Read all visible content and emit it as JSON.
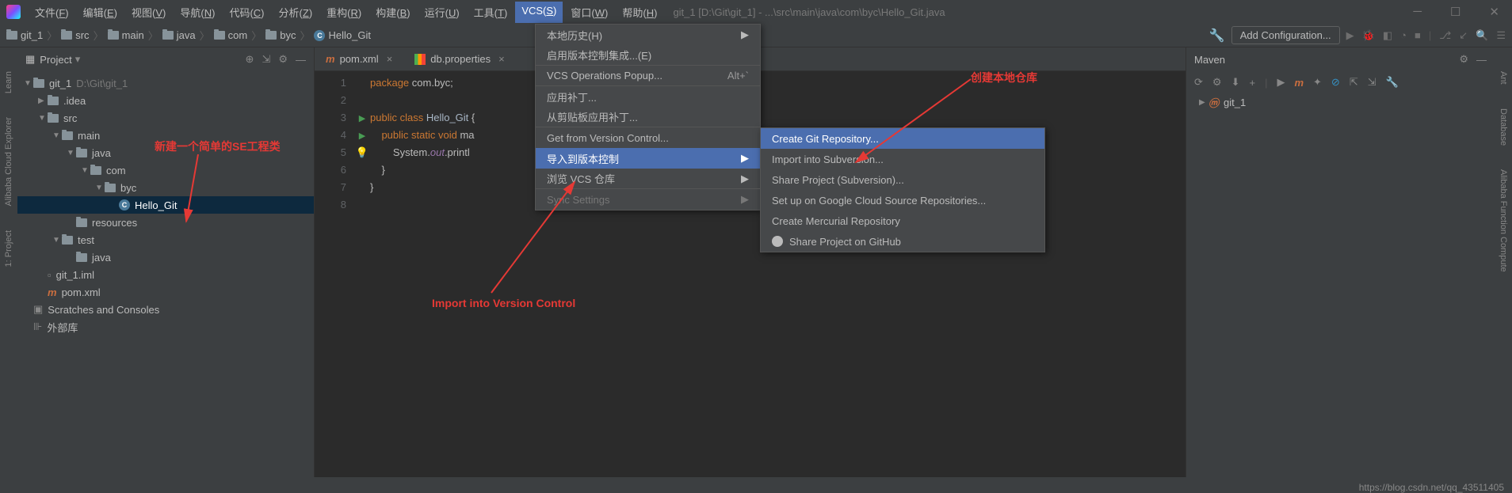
{
  "menubar": [
    "文件(F)",
    "编辑(E)",
    "视图(V)",
    "导航(N)",
    "代码(C)",
    "分析(Z)",
    "重构(R)",
    "构建(B)",
    "运行(U)",
    "工具(T)",
    "VCS(S)",
    "窗口(W)",
    "帮助(H)"
  ],
  "menubar_active_index": 10,
  "title_path": "git_1 [D:\\Git\\git_1] - ...\\src\\main\\java\\com\\byc\\Hello_Git.java",
  "breadcrumbs": [
    "git_1",
    "src",
    "main",
    "java",
    "com",
    "byc",
    "Hello_Git"
  ],
  "add_config": "Add Configuration...",
  "project_panel": {
    "title": "Project",
    "tree": [
      {
        "depth": 0,
        "arrow": "▼",
        "icon": "folder-root",
        "label": "git_1",
        "suffix": "D:\\Git\\git_1"
      },
      {
        "depth": 1,
        "arrow": "▶",
        "icon": "folder",
        "label": ".idea"
      },
      {
        "depth": 1,
        "arrow": "▼",
        "icon": "folder",
        "label": "src"
      },
      {
        "depth": 2,
        "arrow": "▼",
        "icon": "folder",
        "label": "main"
      },
      {
        "depth": 3,
        "arrow": "▼",
        "icon": "folder",
        "label": "java"
      },
      {
        "depth": 4,
        "arrow": "▼",
        "icon": "folder",
        "label": "com"
      },
      {
        "depth": 5,
        "arrow": "▼",
        "icon": "folder",
        "label": "byc"
      },
      {
        "depth": 6,
        "arrow": "",
        "icon": "class",
        "label": "Hello_Git",
        "selected": true
      },
      {
        "depth": 3,
        "arrow": "",
        "icon": "folder",
        "label": "resources"
      },
      {
        "depth": 2,
        "arrow": "▼",
        "icon": "folder",
        "label": "test"
      },
      {
        "depth": 3,
        "arrow": "",
        "icon": "folder",
        "label": "java"
      },
      {
        "depth": 1,
        "arrow": "",
        "icon": "file",
        "label": "git_1.iml"
      },
      {
        "depth": 1,
        "arrow": "",
        "icon": "m",
        "label": "pom.xml"
      },
      {
        "depth": 0,
        "arrow": "",
        "icon": "scratch",
        "label": "Scratches and Consoles"
      },
      {
        "depth": 0,
        "arrow": "",
        "icon": "lib",
        "label": "外部库"
      }
    ]
  },
  "tabs": [
    {
      "icon": "m",
      "label": "pom.xml"
    },
    {
      "icon": "prop",
      "label": "db.properties"
    }
  ],
  "code": {
    "lines": [
      {
        "n": 1,
        "html": "<span class='kw'>package</span> com.byc;"
      },
      {
        "n": 2,
        "html": ""
      },
      {
        "n": 3,
        "html": "<span class='kw'>public class</span> <span class='cls'>Hello_Git</span> {",
        "run": true
      },
      {
        "n": 4,
        "html": "    <span class='kw'>public static void</span> ma",
        "run": true
      },
      {
        "n": 5,
        "html": "        System.<span class='fld'>out</span>.printl",
        "bulb": true
      },
      {
        "n": 6,
        "html": "    }"
      },
      {
        "n": 7,
        "html": "}"
      },
      {
        "n": 8,
        "html": ""
      }
    ]
  },
  "vcs_menu": [
    {
      "label": "本地历史(H)",
      "arrow": true
    },
    {
      "label": "启用版本控制集成...(E)",
      "sep": true
    },
    {
      "label": "VCS Operations Popup...",
      "shortcut": "Alt+`",
      "sep": true
    },
    {
      "label": "应用补丁..."
    },
    {
      "label": "从剪贴板应用补丁...",
      "sep": true
    },
    {
      "label": "Get from Version Control..."
    },
    {
      "label": "导入到版本控制",
      "arrow": true,
      "highlight": true
    },
    {
      "label": "浏览 VCS 仓库",
      "arrow": true,
      "sep": true
    },
    {
      "label": "Sync Settings",
      "arrow": true,
      "disabled": true
    }
  ],
  "vcs_submenu": [
    {
      "label": "Create Git Repository...",
      "highlight": true
    },
    {
      "label": "Import into Subversion..."
    },
    {
      "label": "Share Project (Subversion)..."
    },
    {
      "label": "Set up on Google Cloud Source Repositories..."
    },
    {
      "label": "Create Mercurial Repository"
    },
    {
      "label": "Share Project on GitHub",
      "icon": "github"
    }
  ],
  "maven": {
    "title": "Maven",
    "project": "git_1"
  },
  "annotations": {
    "a1": "新建一个简单的SE工程类",
    "a2": "Import into Version Control",
    "a3": "创建本地仓库"
  },
  "side_left": [
    "Learn",
    "Alibaba Cloud Explorer",
    "1: Project"
  ],
  "side_right": [
    "Ant",
    "Database",
    "Alibaba Function Compute"
  ],
  "footer_url": "https://blog.csdn.net/qq_43511405"
}
